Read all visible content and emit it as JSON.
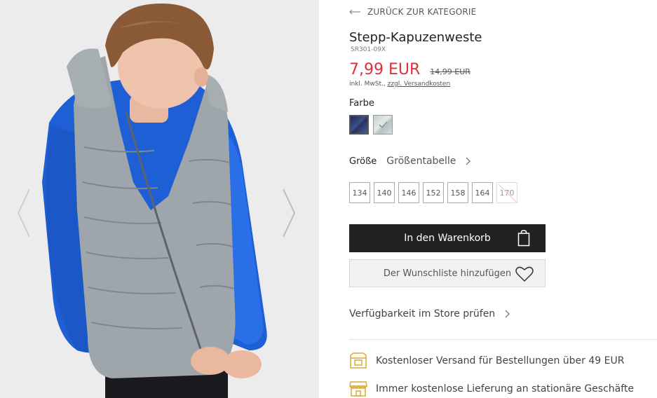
{
  "gallery": {
    "prev_icon": "chevron-left-icon",
    "next_icon": "chevron-right-icon"
  },
  "back_link": {
    "label": "ZURÜCK ZUR KATEGORIE",
    "icon": "arrow-left-icon"
  },
  "product": {
    "title": "Stepp-Kapuzenweste",
    "sku": "SR301-09X",
    "price": "7,99 EUR",
    "old_price": "14,99 EUR",
    "tax_note": "inkl. MwSt.,",
    "shipping_link": "zzgl. Versandkosten",
    "price_color": "#e0303b"
  },
  "color": {
    "label": "Farbe",
    "swatches": [
      {
        "name": "navy",
        "selected": true
      },
      {
        "name": "grey",
        "selected": false
      }
    ]
  },
  "size": {
    "label": "Größe",
    "size_table": "Größentabelle",
    "options": [
      {
        "label": "134",
        "available": true
      },
      {
        "label": "140",
        "available": true
      },
      {
        "label": "146",
        "available": true
      },
      {
        "label": "152",
        "available": true
      },
      {
        "label": "158",
        "available": true
      },
      {
        "label": "164",
        "available": true
      },
      {
        "label": "170",
        "available": false
      }
    ]
  },
  "actions": {
    "add_to_cart": "In den Warenkorb",
    "add_to_cart_icon": "shopping-bag-icon",
    "wishlist": "Der Wunschliste hinzufügen",
    "wishlist_icon": "heart-icon"
  },
  "store_check": {
    "label": "Verfügbarkeit im Store prüfen",
    "icon": "chevron-right-icon"
  },
  "info": [
    {
      "label": "Kostenloser Versand für Bestellungen über 49 EUR",
      "icon": "delivery-box-icon"
    },
    {
      "label": "Immer kostenlose Lieferung an stationäre Geschäfte",
      "icon": "store-icon"
    }
  ],
  "colors": {
    "accent_gold": "#d9a93c",
    "button_dark": "#222222"
  }
}
